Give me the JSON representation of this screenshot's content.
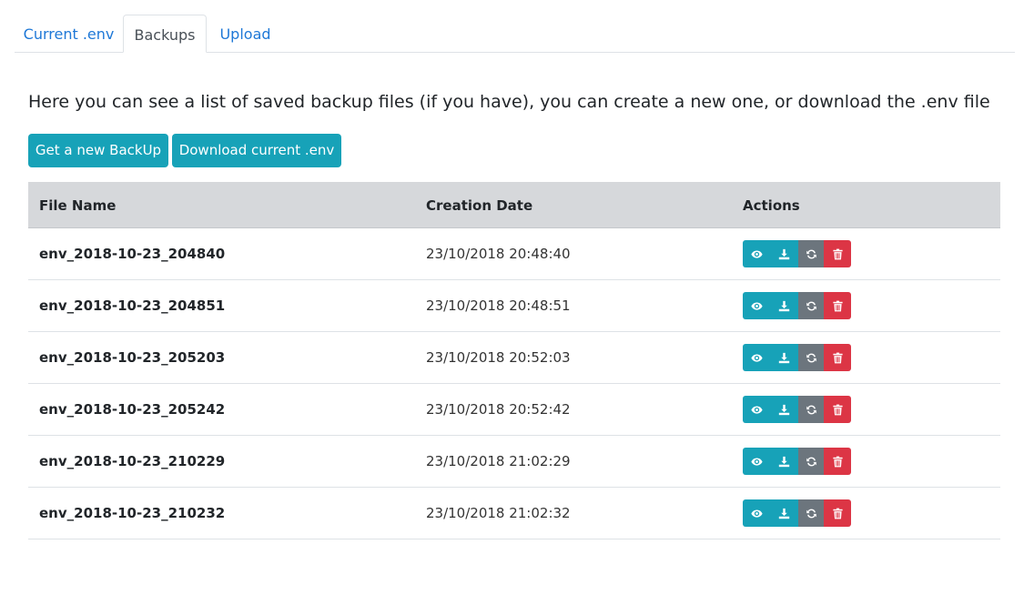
{
  "tabs": [
    {
      "label": "Current .env",
      "active": false
    },
    {
      "label": "Backups",
      "active": true
    },
    {
      "label": "Upload",
      "active": false
    }
  ],
  "intro_text": "Here you can see a list of saved backup files (if you have), you can create a new one, or download the .env file",
  "buttons": {
    "new_backup": "Get a new BackUp",
    "download_env": "Download current .env"
  },
  "table": {
    "headers": {
      "file_name": "File Name",
      "creation_date": "Creation Date",
      "actions": "Actions"
    },
    "rows": [
      {
        "file_name": "env_2018-10-23_204840",
        "creation_date": "23/10/2018 20:48:40"
      },
      {
        "file_name": "env_2018-10-23_204851",
        "creation_date": "23/10/2018 20:48:51"
      },
      {
        "file_name": "env_2018-10-23_205203",
        "creation_date": "23/10/2018 20:52:03"
      },
      {
        "file_name": "env_2018-10-23_205242",
        "creation_date": "23/10/2018 20:52:42"
      },
      {
        "file_name": "env_2018-10-23_210229",
        "creation_date": "23/10/2018 21:02:29"
      },
      {
        "file_name": "env_2018-10-23_210232",
        "creation_date": "23/10/2018 21:02:32"
      }
    ],
    "row_action_icons": [
      "eye-icon",
      "download-icon",
      "refresh-icon",
      "trash-icon"
    ]
  },
  "colors": {
    "info": "#17a2b8",
    "secondary": "#6c757d",
    "danger": "#dc3545",
    "link": "#1e78d7",
    "table_header_bg": "#d6d8db"
  }
}
